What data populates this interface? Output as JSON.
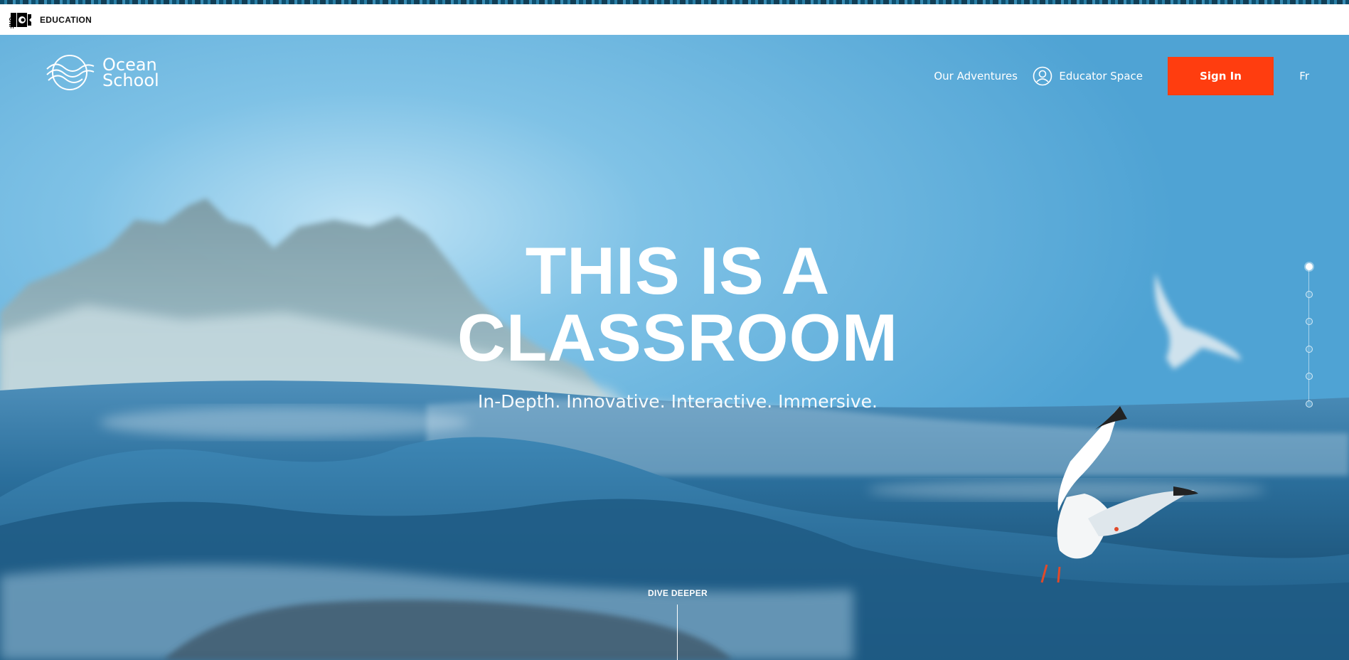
{
  "nfb_bar": {
    "logo_text": "ONF NFB",
    "label": "EDUCATION"
  },
  "header": {
    "brand": {
      "line1": "Ocean",
      "line2": "School"
    },
    "nav": {
      "adventures": "Our Adventures",
      "educator": "Educator Space",
      "signin": "Sign In",
      "language": "Fr"
    }
  },
  "hero": {
    "title_line1": "THIS IS A",
    "title_line2": "CLASSROOM",
    "subtitle": "In-Depth. Innovative. Interactive. Immersive.",
    "dive_label": "DIVE DEEPER"
  },
  "dot_nav": {
    "count": 6,
    "active_index": 0
  },
  "colors": {
    "signin_bg": "#ff3d0f",
    "sky": "#6fb6dd",
    "sea": "#1d5f86"
  },
  "icons": {
    "brand": "wave-logo-icon",
    "educator": "user-circle-icon"
  }
}
